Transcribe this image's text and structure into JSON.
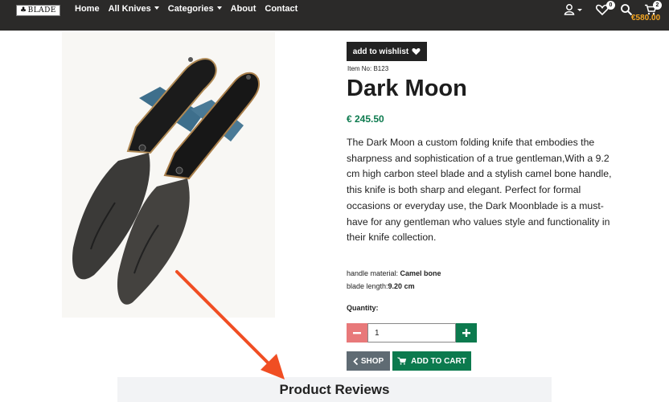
{
  "nav": {
    "logo_text": "BLADE",
    "links": [
      "Home",
      "All Knives",
      "Categories",
      "About",
      "Contact"
    ],
    "wishlist_count": "0",
    "cart_count": "2",
    "cart_total": "€580.00",
    "icons": {
      "user": "user-icon",
      "heart": "heart-icon",
      "search": "search-icon",
      "cart": "cart-icon"
    }
  },
  "product": {
    "wishlist_label": "add to wishlist",
    "item_no": "Item No: B123",
    "title": "Dark Moon",
    "price": "€ 245.50",
    "description": "The Dark Moon a custom folding knife that embodies the sharpness and sophistication of a true gentleman,With a 9.2 cm high carbon steel blade and a stylish camel bone handle, this knife is both sharp and elegant. Perfect for formal occasions or everyday use, the Dark Moonblade is a must-have for any gentleman who values style and functionality in their knife collection.",
    "spec_handle_label": "handle material: ",
    "spec_handle_value": "Camel bone",
    "spec_blade_label": "blade length:",
    "spec_blade_value": "9.20 cm",
    "quantity_label": "Quantity:",
    "quantity_value": "1",
    "shop_label": "SHOP",
    "add_to_cart_label": "ADD TO CART"
  },
  "reviews": {
    "title": "Product Reviews"
  },
  "colors": {
    "nav_bg": "#2b2a29",
    "accent_green": "#0c7a4e",
    "minus_red": "#e8797a",
    "cart_total": "#f5a623",
    "annotation_arrow": "#f04e23"
  }
}
